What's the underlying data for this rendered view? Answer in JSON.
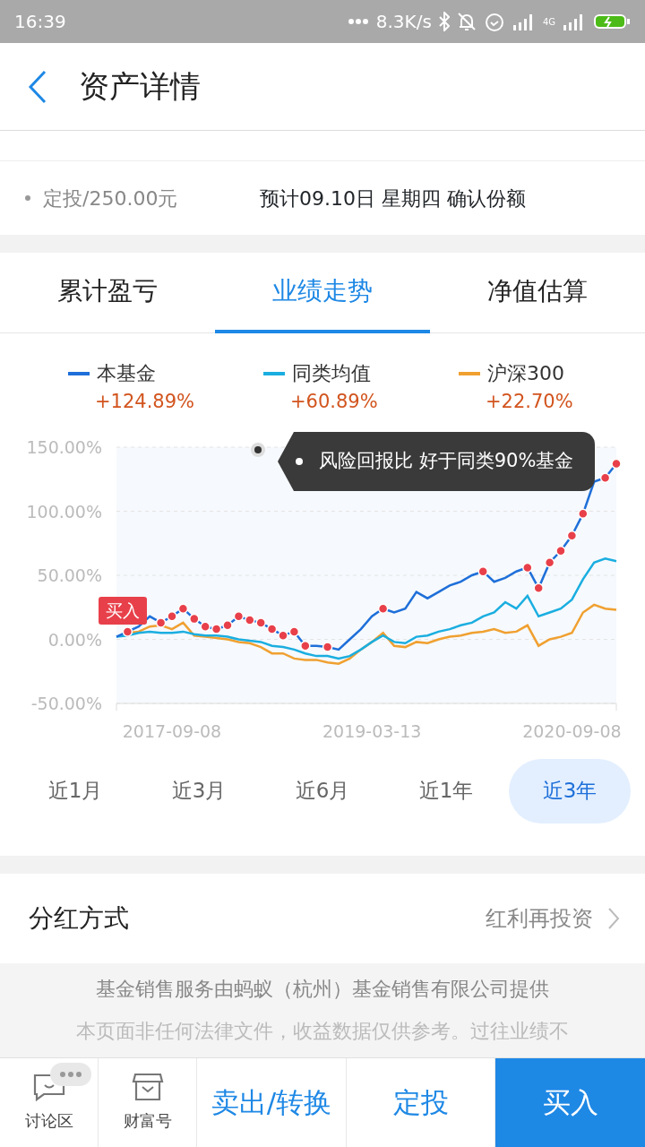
{
  "status_bar": {
    "time": "16:39",
    "speed": "8.3K/s",
    "network": "4G"
  },
  "header": {
    "title": "资产详情"
  },
  "plan": {
    "label": "定投/250.00元",
    "note": "预计09.10日 星期四 确认份额"
  },
  "tabs": [
    {
      "label": "累计盈亏",
      "selected": false
    },
    {
      "label": "业绩走势",
      "selected": true
    },
    {
      "label": "净值估算",
      "selected": false
    }
  ],
  "legend": [
    {
      "value": "+124.89%"
    },
    {
      "value": "+60.89%"
    },
    {
      "value": "+22.70%"
    }
  ],
  "chart_data": {
    "type": "line",
    "grid": true,
    "categories": [
      null,
      null,
      null,
      null,
      null,
      "2017-09-08",
      null,
      null,
      null,
      null,
      null,
      null,
      null,
      null,
      null,
      null,
      null,
      null,
      null,
      null,
      null,
      null,
      null,
      "2019-03-13",
      null,
      null,
      null,
      null,
      null,
      null,
      null,
      null,
      null,
      null,
      null,
      null,
      null,
      null,
      null,
      null,
      null,
      "2020-09-08",
      null,
      null,
      null,
      null
    ],
    "yticks": [
      {
        "value": 150,
        "label": "150.00%"
      },
      {
        "value": 100,
        "label": "100.00%"
      },
      {
        "value": 50,
        "label": "50.00%"
      },
      {
        "value": 0,
        "label": "0.00%"
      },
      {
        "value": -50,
        "label": "-50.00%"
      }
    ],
    "ylim": [
      -50,
      150
    ],
    "series": [
      {
        "name": "本基金",
        "color": "#1e6fd9",
        "values": [
          2,
          6,
          10,
          18,
          13,
          18,
          24,
          16,
          10,
          8,
          11,
          18,
          15,
          13,
          8,
          3,
          6,
          -5,
          -5,
          -6,
          -8,
          0,
          8,
          18,
          24,
          21,
          24,
          37,
          32,
          37,
          42,
          45,
          50,
          53,
          45,
          48,
          53,
          56,
          40,
          60,
          69,
          81,
          98,
          123,
          126,
          137
        ]
      },
      {
        "name": "同类均值",
        "color": "#1aaee0",
        "values": [
          2,
          3,
          5,
          6,
          5,
          5,
          6,
          4,
          3,
          3,
          2,
          0,
          -1,
          -2,
          -5,
          -6,
          -8,
          -11,
          -13,
          -13,
          -15,
          -13,
          -8,
          -2,
          3,
          -2,
          -3,
          2,
          3,
          6,
          8,
          11,
          13,
          18,
          21,
          29,
          24,
          34,
          18,
          21,
          24,
          31,
          47,
          60,
          63,
          61
        ]
      },
      {
        "name": "沪深300",
        "color": "#f0a030",
        "values": [
          null,
          5,
          6,
          10,
          11,
          8,
          13,
          3,
          2,
          1,
          0,
          -2,
          -3,
          -6,
          -11,
          -11,
          -15,
          -16,
          -16,
          -18,
          -19,
          -15,
          -8,
          -2,
          5,
          -5,
          -6,
          -2,
          -3,
          0,
          2,
          3,
          5,
          6,
          8,
          5,
          6,
          11,
          -5,
          0,
          2,
          5,
          21,
          27,
          24,
          23
        ]
      }
    ],
    "annotations": [
      {
        "text": "买入"
      }
    ]
  },
  "tooltip": {
    "text": "风险回报比 好于同类90%基金"
  },
  "ranges": [
    {
      "label": "近1月",
      "selected": false
    },
    {
      "label": "近3月",
      "selected": false
    },
    {
      "label": "近6月",
      "selected": false
    },
    {
      "label": "近1年",
      "selected": false
    },
    {
      "label": "近3年",
      "selected": true
    }
  ],
  "dividend": {
    "label": "分红方式",
    "value": "红利再投资"
  },
  "disclaimer": [
    "基金销售服务由蚂蚁（杭州）基金销售有限公司提供",
    "本页面非任何法律文件，收益数据仅供参考。过往业绩不"
  ],
  "bottom_bar": [
    {
      "kind": "icon",
      "label": "讨论区"
    },
    {
      "kind": "icon",
      "label": "财富号"
    },
    {
      "kind": "text",
      "label": "卖出/转换"
    },
    {
      "kind": "text",
      "label": "定投"
    },
    {
      "kind": "primary",
      "label": "买入"
    }
  ]
}
